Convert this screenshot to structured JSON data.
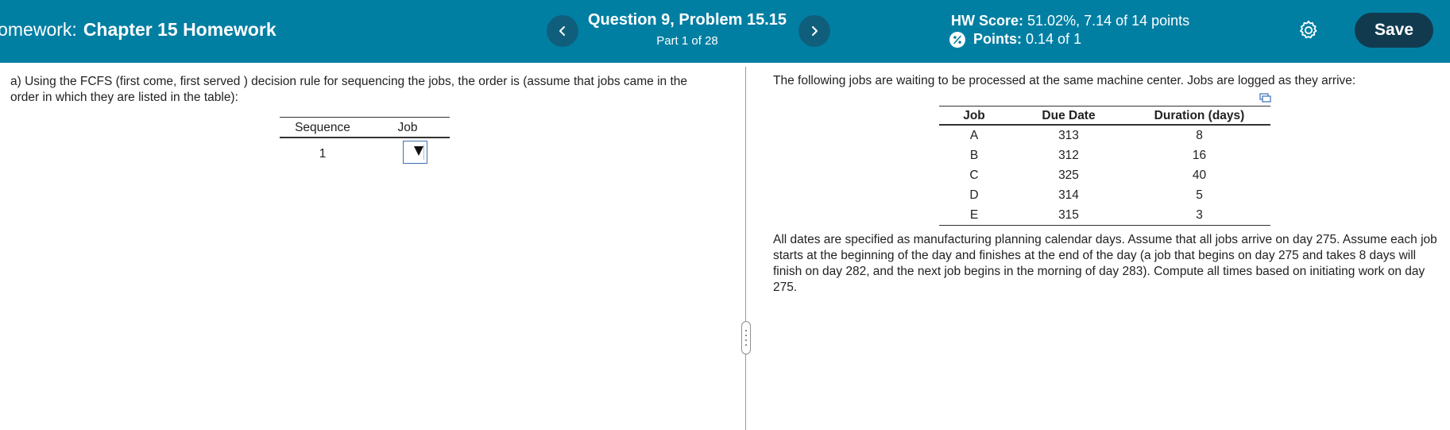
{
  "header": {
    "hw_prefix": "lomework:",
    "chapter_title": "Chapter 15 Homework",
    "question_title": "Question 9, Problem 15.15",
    "part_label": "Part 1 of 28",
    "hw_score_label": "HW Score:",
    "hw_score_value": "51.02%, 7.14 of 14 points",
    "points_label": "Points:",
    "points_value": "0.14 of 1",
    "save_label": "Save",
    "colors": {
      "bar": "#007fa3",
      "nav_button": "#0f5f7c",
      "save_button": "#123a4f"
    },
    "icons": [
      "chevron-left-icon",
      "chevron-right-icon",
      "percent-badge-icon",
      "gear-icon"
    ]
  },
  "left": {
    "instruction": "a) Using the FCFS (first come, first served ) decision rule for sequencing the jobs, the order is (assume that jobs came in the order in which they are listed in the table):",
    "table": {
      "headers": [
        "Sequence",
        "Job"
      ],
      "rows": [
        {
          "sequence": "1",
          "job": ""
        }
      ]
    }
  },
  "right": {
    "intro": "The following jobs are waiting to be processed at the same machine center. Jobs are logged as they arrive:",
    "table": {
      "headers": [
        "Job",
        "Due Date",
        "Duration (days)"
      ],
      "rows": [
        {
          "job": "A",
          "due": "313",
          "duration": "8"
        },
        {
          "job": "B",
          "due": "312",
          "duration": "16"
        },
        {
          "job": "C",
          "due": "325",
          "duration": "40"
        },
        {
          "job": "D",
          "due": "314",
          "duration": "5"
        },
        {
          "job": "E",
          "due": "315",
          "duration": "3"
        }
      ]
    },
    "assumption": "All dates are specified as manufacturing planning calendar days. Assume that all jobs arrive on day 275. Assume each job starts at the beginning of the day and finishes at the end of the day (a job that begins on day 275 and takes 8 days will finish on day 282, and the next job begins in the morning of day 283). Compute all times based on initiating work on day 275."
  }
}
